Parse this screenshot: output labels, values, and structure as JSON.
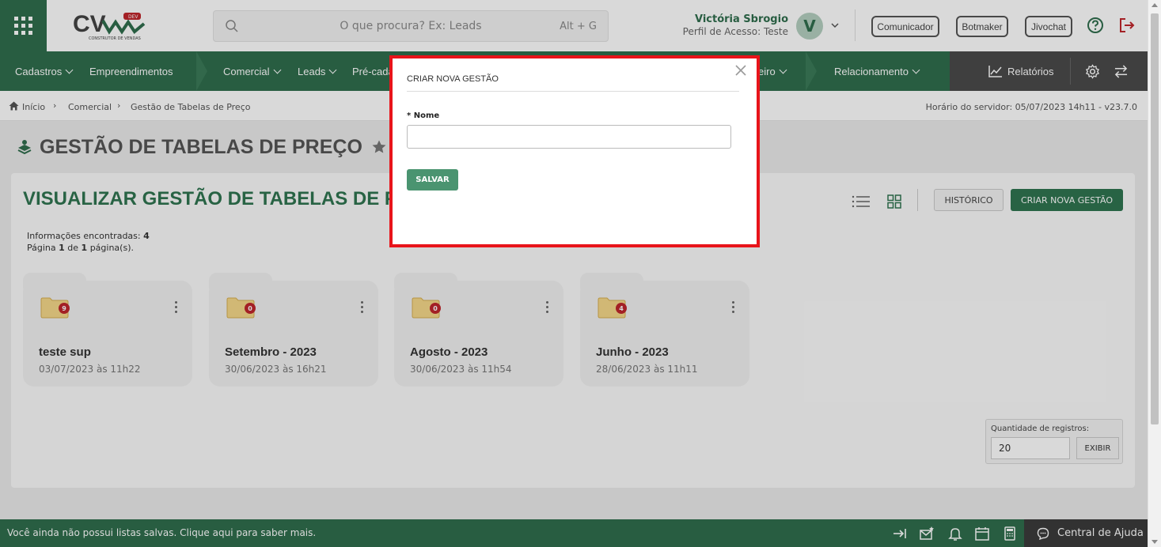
{
  "colors": {
    "brand_green": "#2f6e4d",
    "accent_green": "#2f7551",
    "alert_red": "#e8141a",
    "badge_red": "#c0262c"
  },
  "header": {
    "search_placeholder": "O que procura? Ex: Leads",
    "search_shortcut": "Alt + G",
    "user_name": "Victória Sbrogio",
    "user_profile": "Perfil de Acesso: Teste",
    "avatar_letter": "V",
    "buttons": {
      "comunicador": "Comunicador",
      "botmaker": "Botmaker",
      "jivochat": "Jivochat"
    },
    "logo_main": "CV",
    "logo_badge": "DEV",
    "logo_sub": "CONSTRUTOR DE VENDAS"
  },
  "nav": {
    "cadastros": "Cadastros",
    "empreendimentos": "Empreendimentos",
    "comercial": "Comercial",
    "leads": "Leads",
    "pre_cad": "Pré-cada",
    "financeiro": "eiro",
    "relacionamento": "Relacionamento",
    "relatorios": "Relatórios"
  },
  "breadcrumb": {
    "inicio": "Início",
    "comercial": "Comercial",
    "current": "Gestão de Tabelas de Preço",
    "server_time": "Horário do servidor: 05/07/2023 14h11 - v23.7.0"
  },
  "page": {
    "title": "GESTÃO DE TABELAS DE PREÇO"
  },
  "panel": {
    "title": "VISUALIZAR GESTÃO DE TABELAS DE PRE",
    "info_found_label": "Informações encontradas:",
    "info_found_value": "4",
    "page_label_1": "Página",
    "page_value": "1",
    "page_label_2": "de",
    "page_total": "1",
    "page_label_3": "página(s).",
    "historico": "HISTÓRICO",
    "criar": "CRIAR NOVA GESTÃO",
    "qty_label": "Quantidade de registros:",
    "qty_value": "20",
    "exibir": "EXIBIR"
  },
  "cards": [
    {
      "title": "teste sup",
      "date": "03/07/2023 às 11h22",
      "count": "9"
    },
    {
      "title": "Setembro - 2023",
      "date": "30/06/2023 às 16h21",
      "count": "0"
    },
    {
      "title": "Agosto - 2023",
      "date": "30/06/2023 às 11h54",
      "count": "0"
    },
    {
      "title": "Junho - 2023",
      "date": "28/06/2023 às 11h11",
      "count": "4"
    }
  ],
  "footer": {
    "message": "Você ainda não possui listas salvas. Clique aqui para saber mais.",
    "help": "Central de Ajuda"
  },
  "modal": {
    "title": "CRIAR NOVA GESTÃO",
    "field_label": "* Nome",
    "field_value": "",
    "save": "SALVAR"
  }
}
